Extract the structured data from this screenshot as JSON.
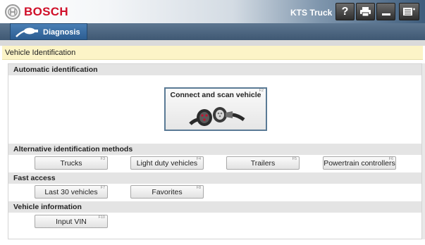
{
  "titlebar": {
    "brand": "BOSCH",
    "product": "KTS Truck",
    "help_glyph": "?",
    "icons": [
      "bosch-logo-icon",
      "help-icon",
      "print-icon",
      "minimize-icon",
      "menu-icon"
    ]
  },
  "nav": {
    "diagnosis_label": "Diagnosis",
    "diagnosis_icon": "probe-icon"
  },
  "breadcrumb": "Vehicle Identification",
  "sections": {
    "automatic": {
      "title": "Automatic identification",
      "connect_button": {
        "label": "Connect and scan vehicle",
        "fkey": "F2",
        "icon": "connector-cable-icon"
      }
    },
    "alternative": {
      "title": "Alternative identification methods",
      "buttons": [
        {
          "label": "Trucks",
          "fkey": "F3"
        },
        {
          "label": "Light duty vehicles",
          "fkey": "F4"
        },
        {
          "label": "Trailers",
          "fkey": "F5"
        },
        {
          "label": "Powertrain controllers",
          "fkey": "F6"
        }
      ]
    },
    "fast_access": {
      "title": "Fast access",
      "buttons": [
        {
          "label": "Last 30 vehicles",
          "fkey": "F7"
        },
        {
          "label": "Favorites",
          "fkey": "F8"
        }
      ]
    },
    "vehicle_info": {
      "title": "Vehicle information",
      "buttons": [
        {
          "label": "Input VIN",
          "fkey": "F10"
        }
      ]
    }
  },
  "colors": {
    "brand_red": "#d0102a",
    "nav_blue": "#3f5873",
    "breadcrumb_bg": "#fcf4c7",
    "section_bg": "#e4e4e4"
  }
}
